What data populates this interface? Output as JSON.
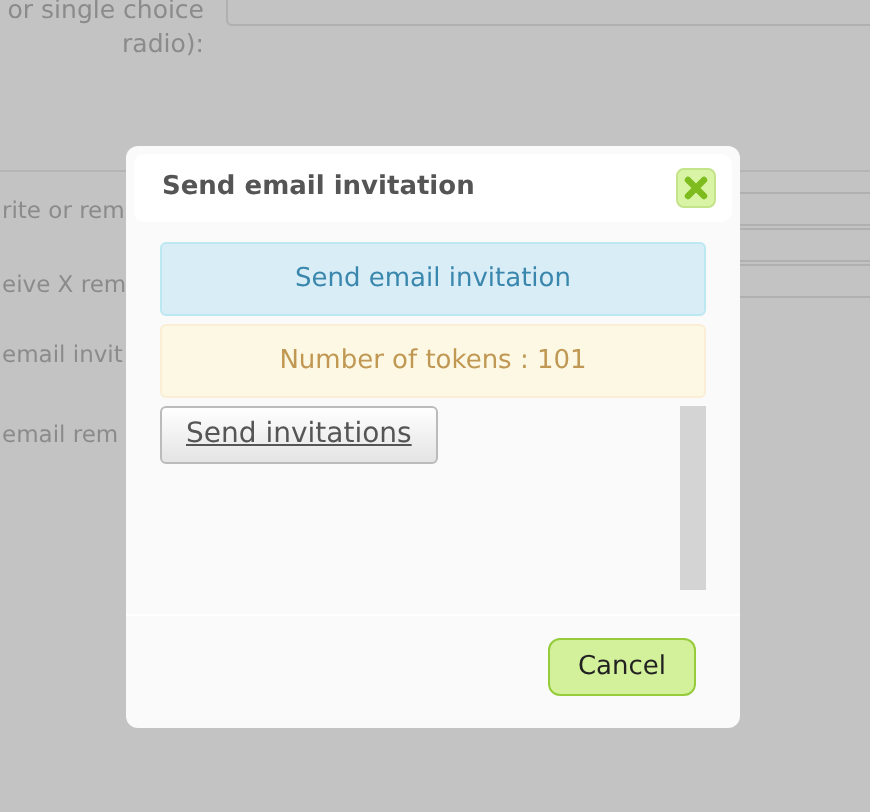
{
  "background_form": {
    "labels": [
      {
        "text": "or single choice radio):"
      },
      {
        "text": "rite or rem"
      },
      {
        "text": "eive X rem"
      },
      {
        "text": "email invit"
      },
      {
        "text": "email rem"
      }
    ]
  },
  "dialog": {
    "title": "Send email invitation",
    "alerts": [
      {
        "kind": "info",
        "text": "Send email invitation"
      },
      {
        "kind": "warning",
        "text": "Number of tokens : 101"
      }
    ],
    "action_button": "Send invitations",
    "cancel_button": "Cancel"
  }
}
